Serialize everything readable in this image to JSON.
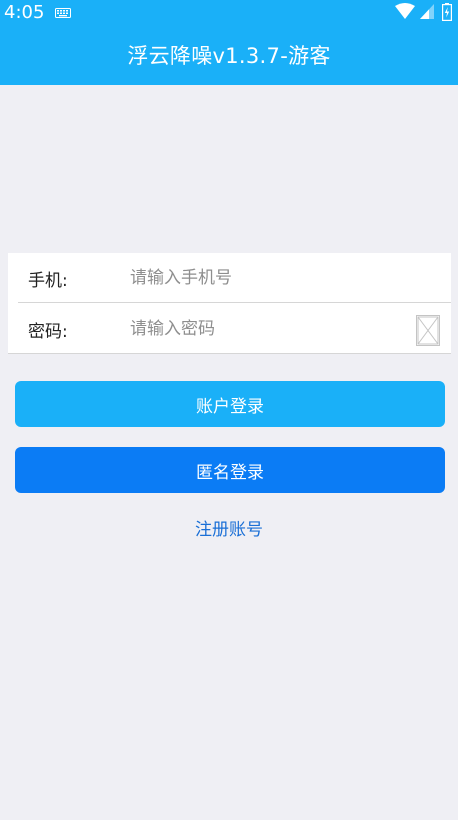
{
  "status_bar": {
    "time": "4:05"
  },
  "app_bar": {
    "title": "浮云降噪v1.3.7-游客"
  },
  "form": {
    "phone_label": "手机:",
    "phone_placeholder": "请输入手机号",
    "phone_value": "",
    "password_label": "密码:",
    "password_placeholder": "请输入密码",
    "password_value": ""
  },
  "buttons": {
    "account_login": "账户登录",
    "anonymous_login": "匿名登录",
    "register": "注册账号"
  },
  "colors": {
    "header": "#1ab0f8",
    "account_button": "#1ab0f8",
    "anonymous_button": "#0b7cf5",
    "link": "#1a6fd6",
    "background": "#efeff4"
  },
  "icons": {
    "keyboard": "keyboard-icon",
    "wifi": "wifi-icon",
    "signal": "signal-icon",
    "battery": "battery-icon",
    "password_toggle": "eye-toggle-icon"
  }
}
